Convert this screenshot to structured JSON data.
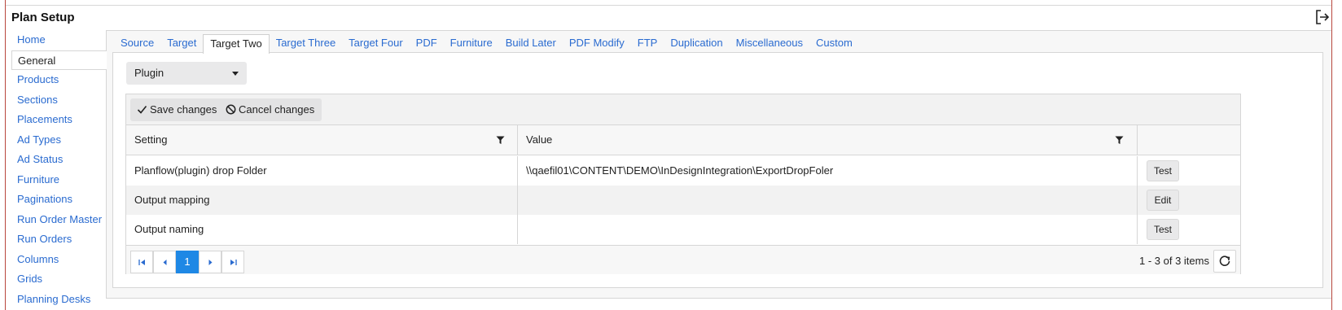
{
  "page_title": "Plan Setup",
  "sidebar": {
    "items": [
      {
        "label": "Home",
        "active": false
      },
      {
        "label": "General",
        "active": true
      },
      {
        "label": "Products",
        "active": false
      },
      {
        "label": "Sections",
        "active": false
      },
      {
        "label": "Placements",
        "active": false
      },
      {
        "label": "Ad Types",
        "active": false
      },
      {
        "label": "Ad Status",
        "active": false
      },
      {
        "label": "Furniture",
        "active": false
      },
      {
        "label": "Paginations",
        "active": false
      },
      {
        "label": "Run Order Master",
        "active": false
      },
      {
        "label": "Run Orders",
        "active": false
      },
      {
        "label": "Columns",
        "active": false
      },
      {
        "label": "Grids",
        "active": false
      },
      {
        "label": "Planning Desks",
        "active": false
      }
    ]
  },
  "tabs": [
    {
      "label": "Source",
      "active": false
    },
    {
      "label": "Target",
      "active": false
    },
    {
      "label": "Target Two",
      "active": true
    },
    {
      "label": "Target Three",
      "active": false
    },
    {
      "label": "Target Four",
      "active": false
    },
    {
      "label": "PDF",
      "active": false
    },
    {
      "label": "Furniture",
      "active": false
    },
    {
      "label": "Build Later",
      "active": false
    },
    {
      "label": "PDF Modify",
      "active": false
    },
    {
      "label": "FTP",
      "active": false
    },
    {
      "label": "Duplication",
      "active": false
    },
    {
      "label": "Miscellaneous",
      "active": false
    },
    {
      "label": "Custom",
      "active": false
    }
  ],
  "dropdown": {
    "selected": "Plugin"
  },
  "toolbar": {
    "save_label": "Save changes",
    "cancel_label": "Cancel changes"
  },
  "grid": {
    "columns": [
      "Setting",
      "Value",
      ""
    ],
    "rows": [
      {
        "setting": "Planflow(plugin) drop Folder",
        "value": "\\\\qaefil01\\CONTENT\\DEMO\\InDesignIntegration\\ExportDropFoler",
        "action": "Test"
      },
      {
        "setting": "Output mapping",
        "value": "",
        "action": "Edit"
      },
      {
        "setting": "Output naming",
        "value": "",
        "action": "Test"
      }
    ]
  },
  "pager": {
    "current_page": "1",
    "info": "1 - 3 of 3 items"
  },
  "colors": {
    "link": "#2a6bd0",
    "accent": "#1e88e5",
    "border": "#d6d6d6"
  }
}
